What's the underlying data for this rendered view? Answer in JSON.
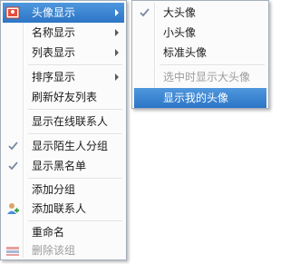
{
  "main_menu": {
    "items": [
      {
        "label": "头像显示"
      },
      {
        "label": "名称显示"
      },
      {
        "label": "列表显示"
      },
      {
        "label": "排序显示"
      },
      {
        "label": "刷新好友列表"
      },
      {
        "label": "显示在线联系人"
      },
      {
        "label": "显示陌生人分组"
      },
      {
        "label": "显示黑名单"
      },
      {
        "label": "添加分组"
      },
      {
        "label": "添加联系人"
      },
      {
        "label": "重命名"
      },
      {
        "label": "删除该组"
      }
    ]
  },
  "sub_menu": {
    "items": [
      {
        "label": "大头像"
      },
      {
        "label": "小头像"
      },
      {
        "label": "标准头像"
      },
      {
        "label": "选中时显示大头像"
      },
      {
        "label": "显示我的头像"
      }
    ]
  },
  "colors": {
    "highlight": "#2c75c6",
    "disabled_text": "#9c9c9c",
    "check": "#7a8aa0"
  }
}
